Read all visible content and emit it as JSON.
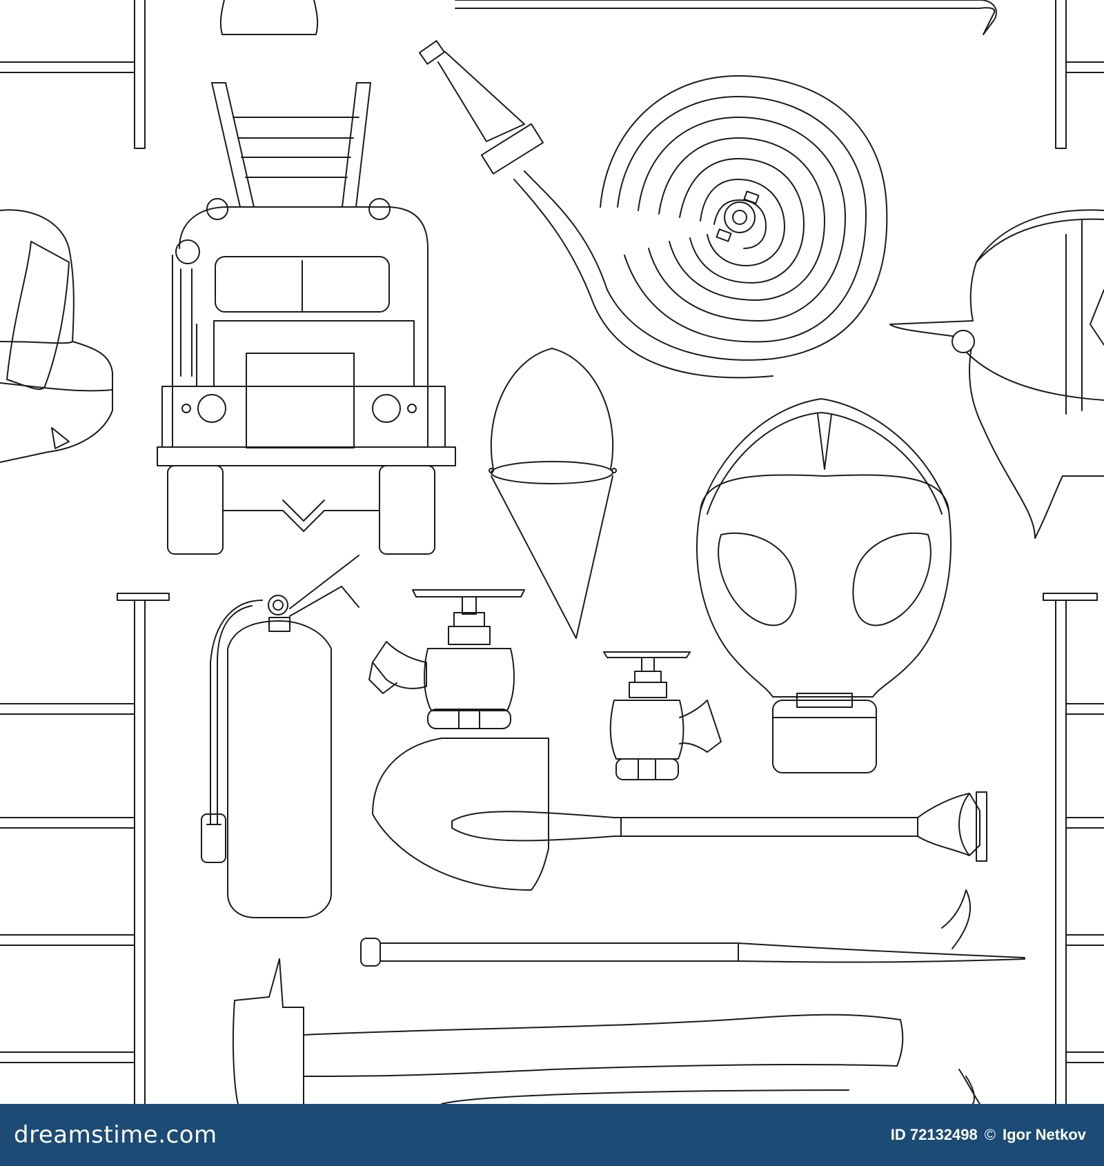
{
  "image": {
    "description_hidden": true,
    "style": "seamless black outline pattern of firefighting equipment on white background",
    "stroke_color": "#1a1a1a",
    "background_color": "#ffffff"
  },
  "footer": {
    "brand": "dreamstime.com",
    "id_label": "ID 72132498",
    "copyright_mark": "©",
    "author": "Igor Netkov",
    "background_color": "#1c4b76",
    "text_color": "#ffffff"
  }
}
